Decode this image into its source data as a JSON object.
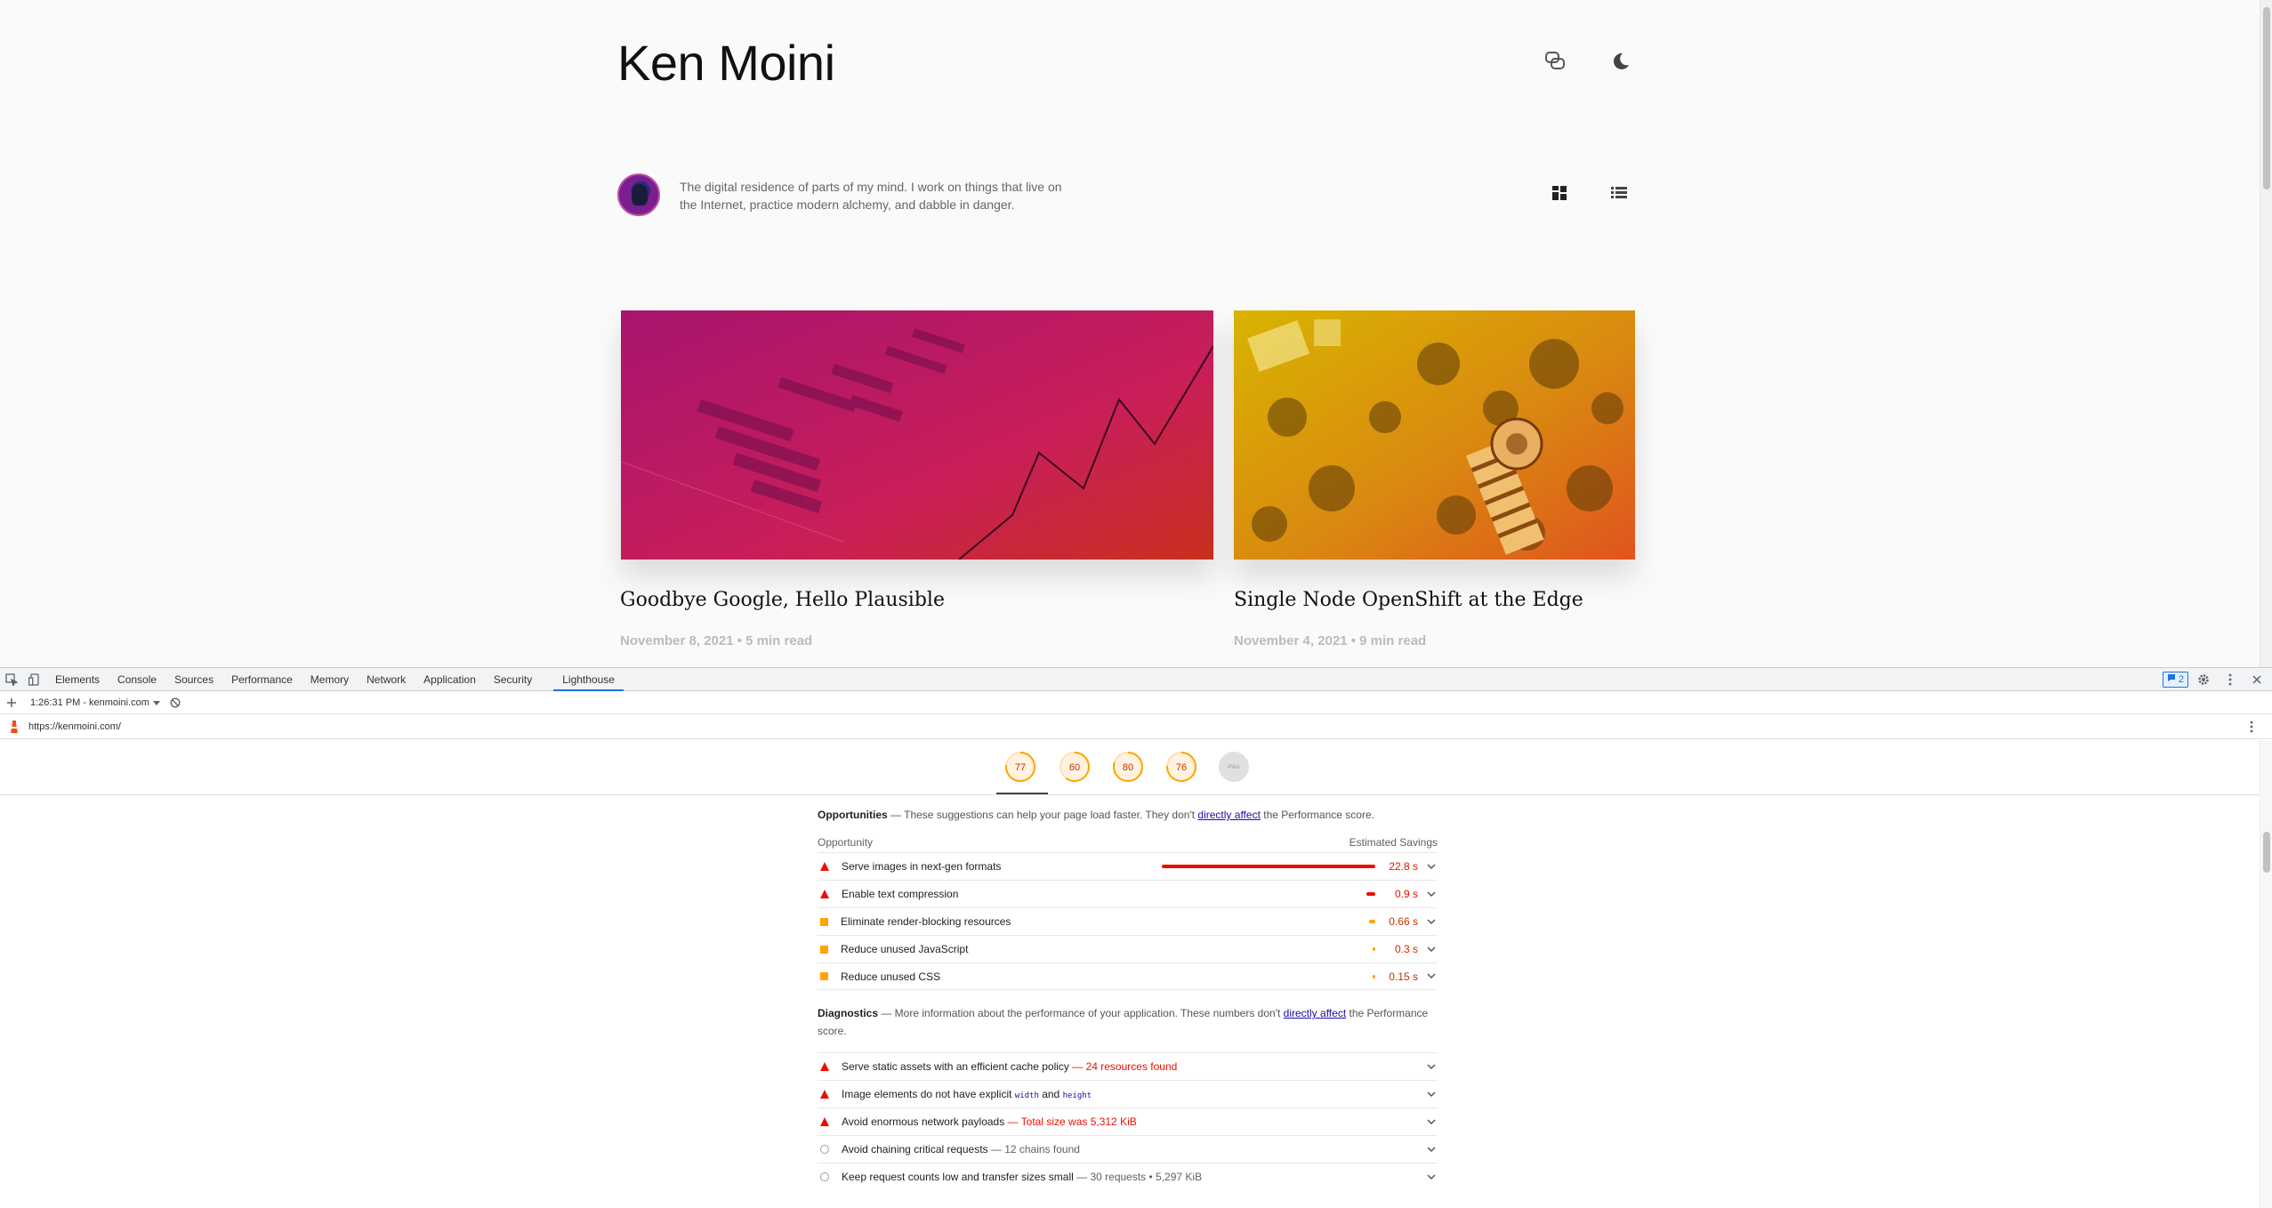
{
  "site": {
    "title": "Ken Moini",
    "bio": "The digital residence of parts of my mind. I work on things that live on the Internet, practice modern alchemy, and dabble in danger.",
    "posts": [
      {
        "title": "Goodbye Google, Hello Plausible",
        "date": "November 8, 2021",
        "read": "5 min read"
      },
      {
        "title": "Single Node OpenShift at the Edge",
        "date": "November 4, 2021",
        "read": "9 min read"
      }
    ]
  },
  "devtools": {
    "tabs": [
      "Elements",
      "Console",
      "Sources",
      "Performance",
      "Memory",
      "Network",
      "Application",
      "Security",
      "Lighthouse"
    ],
    "active_tab": "Lighthouse",
    "issues_count": "2",
    "report_select": "1:26:31 PM - kenmoini.com",
    "url": "https://kenmoini.com/",
    "gauges": [
      {
        "score": "77",
        "color": "#ffa400",
        "fraction": 0.77
      },
      {
        "score": "60",
        "color": "#ffa400",
        "fraction": 0.6
      },
      {
        "score": "80",
        "color": "#ffa400",
        "fraction": 0.8
      },
      {
        "score": "76",
        "color": "#ffa400",
        "fraction": 0.76
      },
      {
        "score": "PWA",
        "color": "#cccccc",
        "fraction": 0
      }
    ]
  },
  "opportunities": {
    "title": "Opportunities",
    "desc_pre": " — These suggestions can help your page load faster. They don't ",
    "link": "directly affect",
    "desc_post": " the Performance score.",
    "col_left": "Opportunity",
    "col_right": "Estimated Savings",
    "items": [
      {
        "label": "Serve images in next-gen formats",
        "value": "22.8 s",
        "severity": "fail",
        "bar": 1.0
      },
      {
        "label": "Enable text compression",
        "value": "0.9 s",
        "severity": "fail",
        "bar": 0.04
      },
      {
        "label": "Eliminate render-blocking resources",
        "value": "0.66 s",
        "severity": "average",
        "bar": 0.03
      },
      {
        "label": "Reduce unused JavaScript",
        "value": "0.3 s",
        "severity": "average",
        "bar": 0.013
      },
      {
        "label": "Reduce unused CSS",
        "value": "0.15 s",
        "severity": "average",
        "bar": 0.007
      }
    ]
  },
  "diagnostics": {
    "title": "Diagnostics",
    "desc_pre": " — More information about the performance of your application. These numbers don't ",
    "link": "directly affect",
    "desc_post": " the Performance score.",
    "items": [
      {
        "label": "Serve static assets with an efficient cache policy",
        "detail": " — 24 resources found",
        "severity": "fail"
      },
      {
        "label": "Image elements do not have explicit ",
        "code1": "width",
        "mid": " and ",
        "code2": "height",
        "severity": "fail"
      },
      {
        "label": "Avoid enormous network payloads",
        "detail": " — Total size was 5,312 KiB",
        "severity": "fail"
      },
      {
        "label": "Avoid chaining critical requests",
        "detail": " — 12 chains found",
        "severity": "info"
      },
      {
        "label": "Keep request counts low and transfer sizes small",
        "detail": " — 30 requests • 5,297 KiB",
        "severity": "info"
      }
    ]
  }
}
